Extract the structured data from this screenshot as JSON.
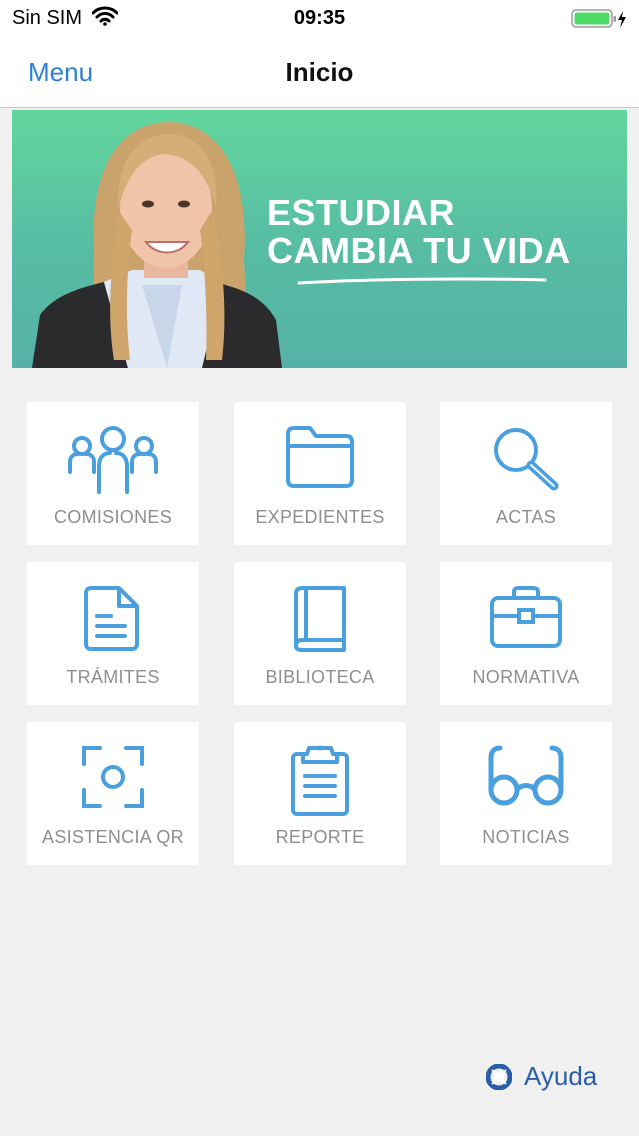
{
  "status_bar": {
    "carrier": "Sin SIM",
    "time": "09:35",
    "wifi_icon": "wifi-icon",
    "battery_icon": "battery-charging-icon",
    "battery_color": "#4cd964"
  },
  "nav": {
    "menu_label": "Menu",
    "title": "Inicio"
  },
  "banner": {
    "line1": "ESTUDIAR",
    "line2": "CAMBIA TU VIDA",
    "gradient_top": "#62d69d",
    "gradient_bottom": "#56b2a6"
  },
  "tiles": [
    {
      "label": "COMISIONES",
      "icon": "people-group-icon"
    },
    {
      "label": "EXPEDIENTES",
      "icon": "folder-icon"
    },
    {
      "label": "ACTAS",
      "icon": "search-icon"
    },
    {
      "label": "TRÁMITES",
      "icon": "document-icon"
    },
    {
      "label": "BIBLIOTECA",
      "icon": "book-icon"
    },
    {
      "label": "NORMATIVA",
      "icon": "briefcase-icon"
    },
    {
      "label": "ASISTENCIA QR",
      "icon": "qr-scan-icon"
    },
    {
      "label": "REPORTE",
      "icon": "clipboard-icon"
    },
    {
      "label": "NOTICIAS",
      "icon": "glasses-icon"
    }
  ],
  "icon_color": "#4a9fdf",
  "help": {
    "label": "Ayuda",
    "icon": "lifebuoy-icon"
  }
}
